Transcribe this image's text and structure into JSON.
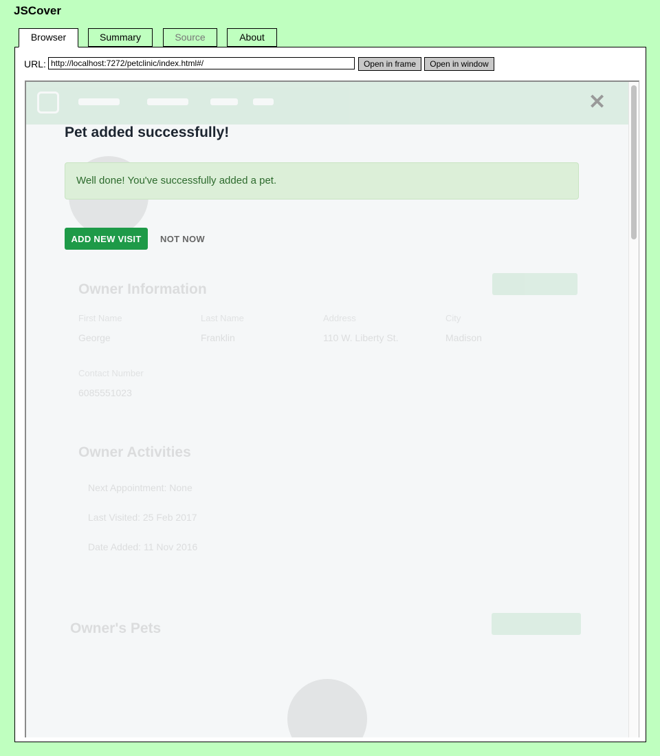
{
  "app": {
    "title": "JSCover"
  },
  "tabs": [
    {
      "label": "Browser",
      "active": true
    },
    {
      "label": "Summary",
      "active": false
    },
    {
      "label": "Source",
      "active": false,
      "disabled": true
    },
    {
      "label": "About",
      "active": false
    }
  ],
  "url_bar": {
    "label": "URL:",
    "value": "http://localhost:7272/petclinic/index.html#/",
    "open_frame_label": "Open in frame",
    "open_window_label": "Open in window"
  },
  "modal": {
    "close_glyph": "✕",
    "title": "Pet added successfully!",
    "alert_text": "Well done! You've successfully added a pet.",
    "primary_button": "ADD NEW VISIT",
    "secondary_button": "NOT NOW",
    "colors": {
      "primary": "#1e9a48",
      "alert_bg": "#dcefd8",
      "alert_text": "#2c6a2c"
    }
  },
  "background_page": {
    "owner_info_heading": "Owner Information",
    "first_name_label": "First Name",
    "first_name": "George",
    "last_name_label": "Last Name",
    "last_name": "Franklin",
    "address_label": "Address",
    "address": "110 W. Liberty St.",
    "city_label": "City",
    "city": "Madison",
    "phone_label": "Contact Number",
    "phone": "6085551023",
    "activities_heading": "Owner Activities",
    "next_appointment": "Next Appointment: None",
    "last_visited": "Last Visited: 25 Feb 2017",
    "date_added": "Date Added: 11 Nov 2016",
    "pets_heading": "Owner's Pets"
  }
}
